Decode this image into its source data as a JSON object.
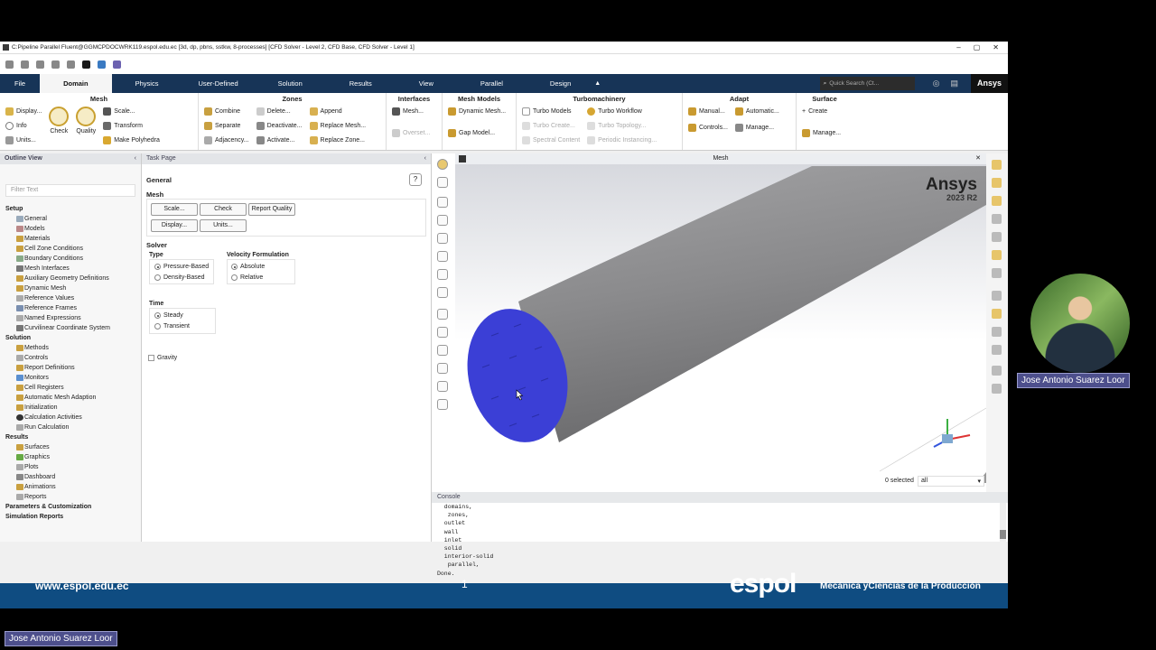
{
  "window": {
    "title": "C:Pipeline Parallel Fluent@GGMCPDOCWRK119.espol.edu.ec  [3d, dp, pbns, sstkw, 8-processes] [CFD Solver - Level 2, CFD Base, CFD Solver - Level 1]",
    "minimize": "–",
    "maximize": "▢",
    "close": "✕"
  },
  "menubar": {
    "tabs": [
      "File",
      "Domain",
      "Physics",
      "User-Defined",
      "Solution",
      "Results",
      "View",
      "Parallel",
      "Design"
    ],
    "active": "Domain",
    "search_placeholder": "Quick Search (Ct...",
    "brand": "Ansys"
  },
  "ribbon": {
    "mesh": {
      "title": "Mesh",
      "display": "Display...",
      "info": "Info",
      "units": "Units...",
      "check": "Check",
      "quality": "Quality",
      "scale": "Scale...",
      "transform": "Transform",
      "polyhedra": "Make Polyhedra"
    },
    "zones": {
      "title": "Zones",
      "combine": "Combine",
      "separate": "Separate",
      "adjacency": "Adjacency...",
      "delete": "Delete...",
      "deactivate": "Deactivate...",
      "activate": "Activate...",
      "append": "Append",
      "replace_mesh": "Replace Mesh...",
      "replace_zone": "Replace Zone..."
    },
    "interfaces": {
      "title": "Interfaces",
      "mesh": "Mesh...",
      "overset": "Overset..."
    },
    "mesh_models": {
      "title": "Mesh Models",
      "dynamic": "Dynamic Mesh...",
      "gap": "Gap Model..."
    },
    "turbo": {
      "title": "Turbomachinery",
      "models": "Turbo Models",
      "create": "Turbo Create...",
      "spectral": "Spectral Content",
      "workflow": "Turbo Workflow",
      "topology": "Turbo Topology...",
      "periodic": "Periodic Instancing..."
    },
    "adapt": {
      "title": "Adapt",
      "manual": "Manual...",
      "controls": "Controls...",
      "automatic": "Automatic...",
      "manage": "Manage..."
    },
    "surface": {
      "title": "Surface",
      "create": "Create",
      "manage": "Manage..."
    }
  },
  "outline": {
    "title": "Outline View",
    "filter_placeholder": "Filter Text",
    "setup": "Setup",
    "setup_items": [
      "General",
      "Models",
      "Materials",
      "Cell Zone Conditions",
      "Boundary Conditions",
      "Mesh Interfaces",
      "Auxiliary Geometry Definitions",
      "Dynamic Mesh",
      "Reference Values",
      "Reference Frames",
      "Named Expressions",
      "Curvilinear Coordinate System"
    ],
    "solution": "Solution",
    "solution_items": [
      "Methods",
      "Controls",
      "Report Definitions",
      "Monitors",
      "Cell Registers",
      "Automatic Mesh Adaption",
      "Initialization",
      "Calculation Activities",
      "Run Calculation"
    ],
    "results": "Results",
    "results_items": [
      "Surfaces",
      "Graphics",
      "Plots",
      "Dashboard",
      "Animations",
      "Reports"
    ],
    "extra": [
      "Parameters & Customization",
      "Simulation Reports"
    ]
  },
  "task": {
    "title": "Task Page",
    "heading": "General",
    "mesh_label": "Mesh",
    "scale": "Scale...",
    "check": "Check",
    "report_quality": "Report Quality",
    "display": "Display...",
    "units": "Units...",
    "solver_label": "Solver",
    "type_label": "Type",
    "pressure": "Pressure-Based",
    "density": "Density-Based",
    "velocity_label": "Velocity Formulation",
    "absolute": "Absolute",
    "relative": "Relative",
    "time_label": "Time",
    "steady": "Steady",
    "transient": "Transient",
    "gravity": "Gravity"
  },
  "viewport": {
    "title": "Mesh",
    "brand": "Ansys",
    "version": "2023 R2",
    "selected": "0 selected",
    "filter": "all"
  },
  "console": {
    "title": "Console",
    "lines": [
      "  domains,",
      "   zones,",
      "  outlet",
      "  wall",
      "  inlet",
      "  solid",
      "  interior-solid",
      "   parallel,",
      "Done."
    ]
  },
  "footer": {
    "website": "www.espol.edu.ec",
    "logo": "espol",
    "faculty": "Mecánica yCiencias de la Producción",
    "page": "1"
  },
  "presenter": "Jose Antonio Suarez Loor",
  "colors": {
    "menubar": "#173457",
    "footer": "#0f4c81",
    "inlet": "#3b3fd6"
  }
}
